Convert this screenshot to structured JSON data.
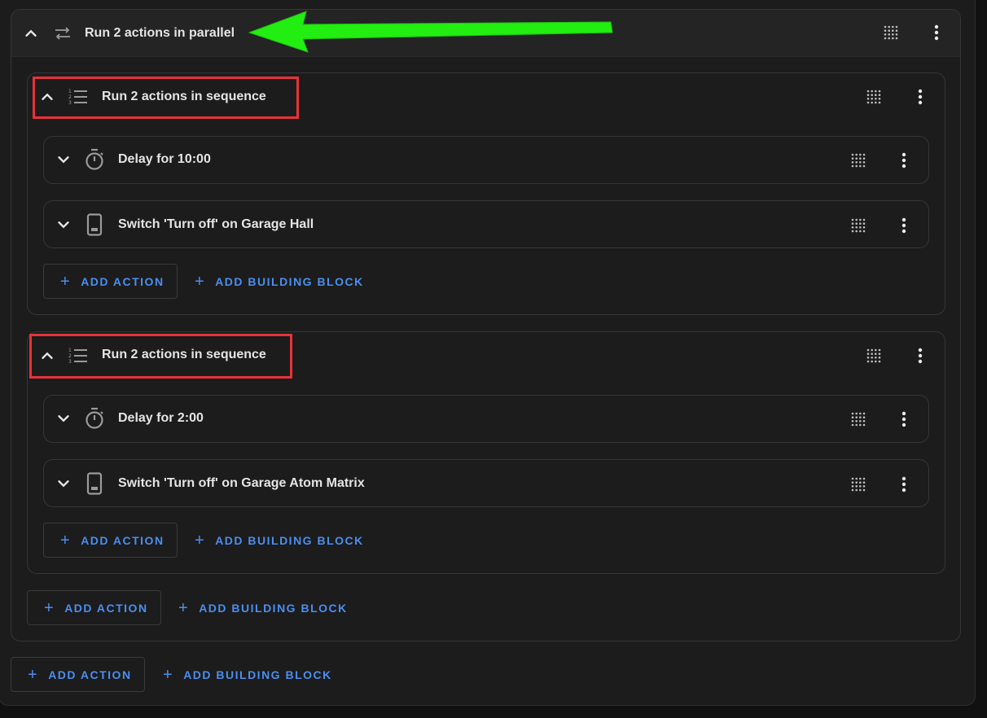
{
  "parallel": {
    "title": "Run 2 actions in parallel",
    "add_action": "ADD ACTION",
    "add_building_block": "ADD BUILDING BLOCK"
  },
  "sequences": [
    {
      "title": "Run 2 actions in sequence",
      "actions": [
        {
          "title": "Delay for 10:00",
          "icon": "timer-icon"
        },
        {
          "title": "Switch 'Turn off' on Garage Hall",
          "icon": "device-icon"
        }
      ],
      "add_action": "ADD ACTION",
      "add_building_block": "ADD BUILDING BLOCK"
    },
    {
      "title": "Run 2 actions in sequence",
      "actions": [
        {
          "title": "Delay for 2:00",
          "icon": "timer-icon"
        },
        {
          "title": "Switch 'Turn off' on Garage Atom Matrix",
          "icon": "device-icon"
        }
      ],
      "add_action": "ADD ACTION",
      "add_building_block": "ADD BUILDING BLOCK"
    }
  ],
  "root": {
    "add_action": "ADD ACTION",
    "add_building_block": "ADD BUILDING BLOCK"
  },
  "plus_symbol": "+",
  "colors": {
    "accent": "#4b8ef0",
    "annotation_red": "#e8323a",
    "annotation_green": "#22ee11"
  }
}
